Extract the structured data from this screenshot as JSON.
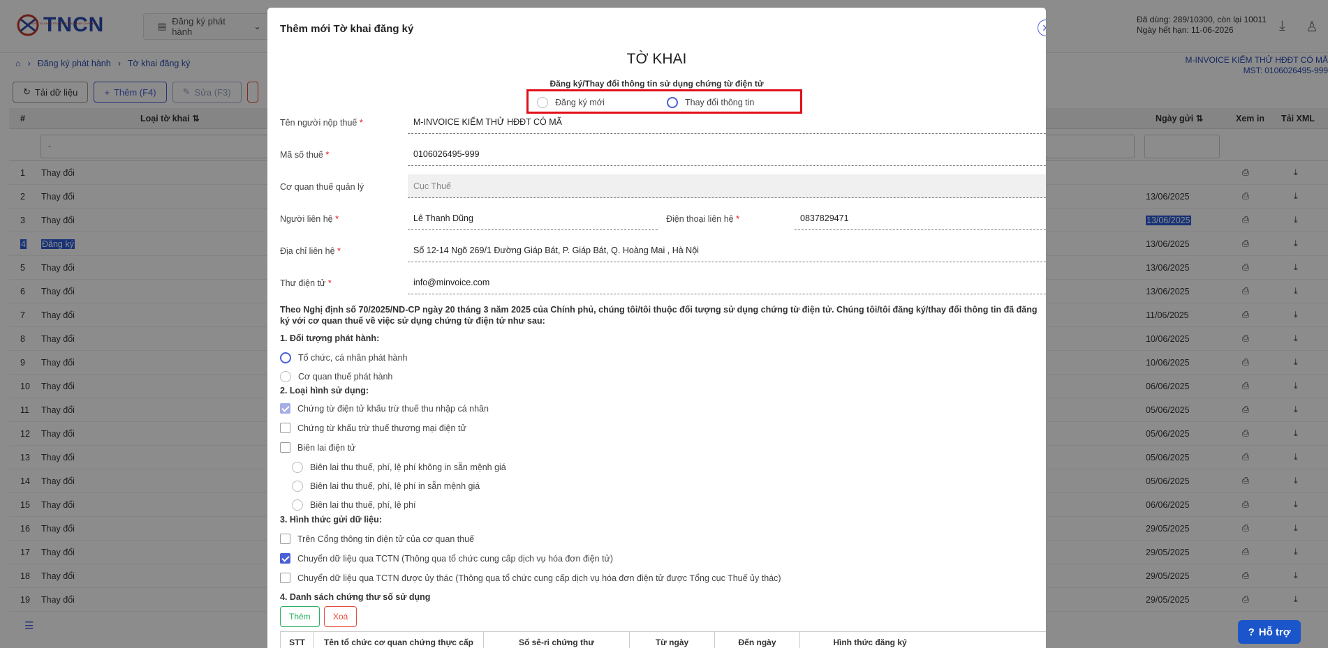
{
  "app": {
    "logo_text": "TNCN",
    "logo_sub": "CHỨNG TỪ KHẤU TRỪ THUẾ THU NHẬP CÁ NHÂN",
    "top_menu": "Đăng ký phát hành",
    "quota_used": "Đã dùng: 289/10300, còn lại 10011",
    "quota_expire": "Ngày hết hạn: 11-06-2026",
    "org_name": "M-INVOICE KIỂM THỬ HĐĐT CÓ MÃ",
    "org_mst": "MST: 0106026495-999"
  },
  "breadcrumb": [
    "Đăng ký phát hành",
    "Tờ khai đăng ký"
  ],
  "toolbar": {
    "reload": "Tải dữ liệu",
    "add": "Thêm (F4)",
    "edit": "Sửa (F3)"
  },
  "grid": {
    "headers": {
      "num": "#",
      "type": "Loại tờ khai",
      "date": "Ngày gửi",
      "print": "Xem in",
      "xml": "Tải XML"
    },
    "filter_value": "-",
    "rows": [
      {
        "n": "1",
        "type": "Thay đổi",
        "date": ""
      },
      {
        "n": "2",
        "type": "Thay đổi",
        "date": "13/06/2025"
      },
      {
        "n": "3",
        "type": "Thay đổi",
        "date": "13/06/2025"
      },
      {
        "n": "4",
        "type": "Đăng ký",
        "date": "13/06/2025"
      },
      {
        "n": "5",
        "type": "Thay đổi",
        "date": "13/06/2025"
      },
      {
        "n": "6",
        "type": "Thay đổi",
        "date": "13/06/2025"
      },
      {
        "n": "7",
        "type": "Thay đổi",
        "date": "11/06/2025"
      },
      {
        "n": "8",
        "type": "Thay đổi",
        "date": "10/06/2025"
      },
      {
        "n": "9",
        "type": "Thay đổi",
        "date": "10/06/2025"
      },
      {
        "n": "10",
        "type": "Thay đổi",
        "date": "06/06/2025"
      },
      {
        "n": "11",
        "type": "Thay đổi",
        "date": "05/06/2025"
      },
      {
        "n": "12",
        "type": "Thay đổi",
        "date": "05/06/2025"
      },
      {
        "n": "13",
        "type": "Thay đổi",
        "date": "05/06/2025"
      },
      {
        "n": "14",
        "type": "Thay đổi",
        "date": "05/06/2025"
      },
      {
        "n": "15",
        "type": "Thay đổi",
        "date": "06/06/2025"
      },
      {
        "n": "16",
        "type": "Thay đổi",
        "date": "29/05/2025"
      },
      {
        "n": "17",
        "type": "Thay đổi",
        "date": "29/05/2025"
      },
      {
        "n": "18",
        "type": "Thay đổi",
        "date": "29/05/2025"
      },
      {
        "n": "19",
        "type": "Thay đổi",
        "date": "29/05/2025"
      }
    ]
  },
  "help_label": "Hỗ trợ",
  "modal": {
    "title": "Thêm mới Tờ khai đăng ký",
    "heading": "TỜ KHAI",
    "subheading": "Đăng ký/Thay đổi thông tin sử dụng chứng từ điện tử",
    "mode_new": "Đăng ký mới",
    "mode_change": "Thay đổi thông tin",
    "fields": {
      "taxpayer_label": "Tên người nộp thuế",
      "taxpayer_value": "M-INVOICE KIỂM THỬ HĐĐT CÓ MÃ",
      "tax_code_label": "Mã số thuế",
      "tax_code_value": "0106026495-999",
      "tax_office_label": "Cơ quan thuế quản lý",
      "tax_office_placeholder": "Cục Thuế",
      "contact_label": "Người liên hệ",
      "contact_value": "Lê Thanh Dũng",
      "phone_label": "Điện thoại liên hệ",
      "phone_value": "0837829471",
      "address_label": "Địa chỉ liên hệ",
      "address_value": "Số 12-14 Ngõ 269/1 Đường Giáp Bát, P. Giáp Bát, Q. Hoàng Mai , Hà Nội",
      "email_label": "Thư điện tử",
      "email_value": "info@minvoice.com"
    },
    "declaration": "Theo Nghị định số 70/2025/ND-CP ngày 20 tháng 3 năm 2025 của Chính phủ, chúng tôi/tôi thuộc đối tượng sử dụng chứng từ điện tử. Chúng tôi/tôi đăng ký/thay đổi thông tin đã đăng ký với cơ quan thuế về việc sử dụng chứng từ điện tử như sau:",
    "sec1": "1. Đối tượng phát hành:",
    "sec1_opt1": "Tổ chức, cá nhân phát hành",
    "sec1_opt2": "Cơ quan thuế phát hành",
    "sec2": "2. Loại hình sử dụng:",
    "sec2_opt1": "Chứng từ điện tử khấu trừ thuế thu nhập cá nhân",
    "sec2_opt2": "Chứng từ khấu trừ thuế thương mại điện tử",
    "sec2_opt3": "Biên lai điện tử",
    "sec2_sub1": "Biên lai thu thuế, phí, lệ phí không in sẵn mệnh giá",
    "sec2_sub2": "Biên lai thu thuế, phí, lệ phí in sẵn mệnh giá",
    "sec2_sub3": "Biên lai thu thuế, phí, lệ phí",
    "sec3": "3. Hình thức gửi dữ liệu:",
    "sec3_opt1": "Trên Cổng thông tin điện tử của cơ quan thuế",
    "sec3_opt2": "Chuyển dữ liệu qua TCTN (Thông qua tổ chức cung cấp dịch vụ hóa đơn điện tử)",
    "sec3_opt3": "Chuyển dữ liệu qua TCTN được ủy thác (Thông qua tổ chức cung cấp dịch vụ hóa đơn điện tử được Tổng cục Thuế ủy thác)",
    "sec4": "4. Danh sách chứng thư số sử dụng",
    "btn_add": "Thêm",
    "btn_delete": "Xoá",
    "table_headers": [
      "STT",
      "Tên tổ chức cơ quan chứng thực cấp",
      "Số sê-ri chứng thư",
      "Từ ngày",
      "Đến ngày",
      "Hình thức đăng ký"
    ]
  }
}
